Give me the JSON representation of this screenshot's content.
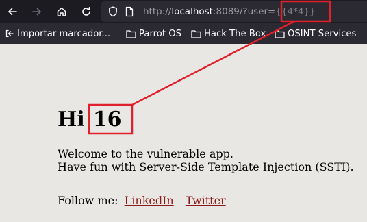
{
  "browser": {
    "url_prefix": "http://",
    "url_host": "localhost",
    "url_suffix": ":8089/?user=",
    "url_injection": "{{4*4}}",
    "bookmarks": [
      "Importar marcador...",
      "Parrot OS",
      "Hack The Box",
      "OSINT Services"
    ]
  },
  "page": {
    "greeting_word": "Hi",
    "greeting_value": "16",
    "line1": "Welcome to the vulnerable app.",
    "line2": "Have fun with Server-Side Template Injection (SSTI).",
    "follow_label": "Follow me:",
    "link_linkedin": "LinkedIn",
    "link_twitter": "Twitter"
  },
  "colors": {
    "annotation": "#e0202a",
    "link": "#8b1a1a",
    "chrome": "#1c1b22",
    "page_bg": "#e9e7e4"
  }
}
